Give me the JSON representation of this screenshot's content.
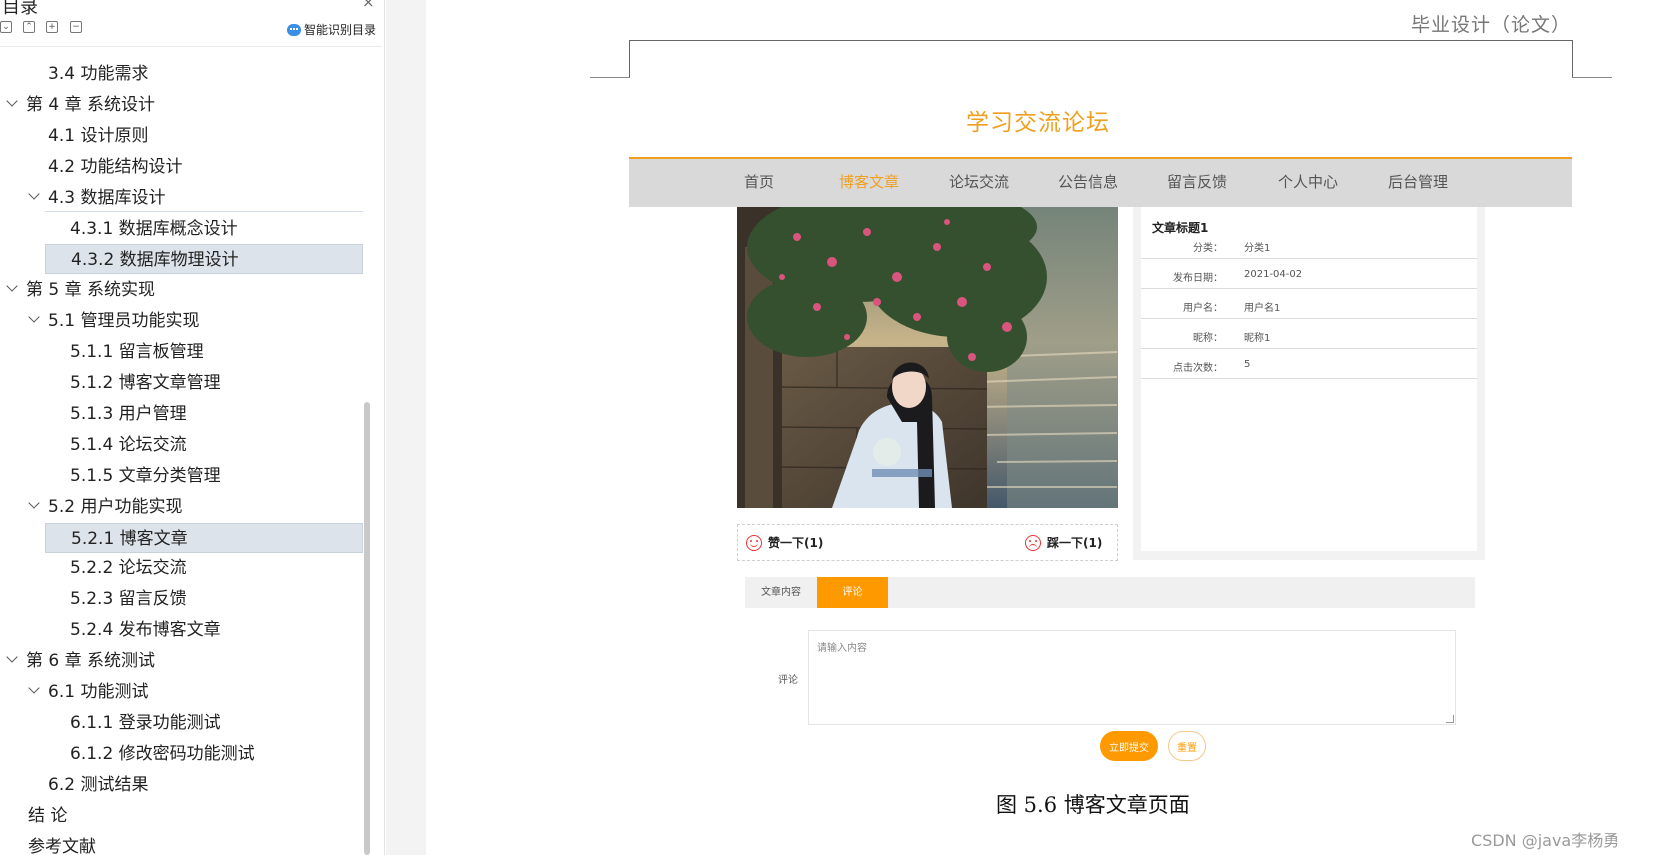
{
  "toc": {
    "title": "目录",
    "close_glyph": "×",
    "tools": [
      {
        "icon": "collapse-all-icon",
        "glyph": "⌄"
      },
      {
        "icon": "expand-up-icon",
        "glyph": "⌃"
      },
      {
        "icon": "plus-icon",
        "glyph": "+"
      },
      {
        "icon": "minus-icon",
        "glyph": "−"
      }
    ],
    "smart_directory": "智能识别目录",
    "items": [
      {
        "label": "3.4  功能需求",
        "level": 1,
        "expandable": false,
        "selected": false
      },
      {
        "label": "第 4 章  系统设计",
        "level": 0,
        "expandable": true,
        "selected": false
      },
      {
        "label": "4.1  设计原则",
        "level": 1,
        "expandable": false,
        "selected": false
      },
      {
        "label": "4.2  功能结构设计",
        "level": 1,
        "expandable": false,
        "selected": false
      },
      {
        "label": "4.3  数据库设计",
        "level": 1,
        "expandable": true,
        "selected": false
      },
      {
        "label": "4.3.1  数据库概念设计",
        "level": 2,
        "expandable": false,
        "selected": false
      },
      {
        "label": "4.3.2  数据库物理设计",
        "level": 2,
        "expandable": false,
        "selected": true
      },
      {
        "label": "第 5 章  系统实现",
        "level": 0,
        "expandable": true,
        "selected": false
      },
      {
        "label": "5.1  管理员功能实现",
        "level": 1,
        "expandable": true,
        "selected": false
      },
      {
        "label": "5.1.1  留言板管理",
        "level": 2,
        "expandable": false,
        "selected": false
      },
      {
        "label": "5.1.2  博客文章管理",
        "level": 2,
        "expandable": false,
        "selected": false
      },
      {
        "label": "5.1.3  用户管理",
        "level": 2,
        "expandable": false,
        "selected": false
      },
      {
        "label": "5.1.4  论坛交流",
        "level": 2,
        "expandable": false,
        "selected": false
      },
      {
        "label": "5.1.5  文章分类管理",
        "level": 2,
        "expandable": false,
        "selected": false
      },
      {
        "label": "5.2  用户功能实现",
        "level": 1,
        "expandable": true,
        "selected": false
      },
      {
        "label": "5.2.1  博客文章",
        "level": 2,
        "expandable": false,
        "selected": true
      },
      {
        "label": "5.2.2  论坛交流",
        "level": 2,
        "expandable": false,
        "selected": false
      },
      {
        "label": "5.2.3  留言反馈",
        "level": 2,
        "expandable": false,
        "selected": false
      },
      {
        "label": "5.2.4  发布博客文章",
        "level": 2,
        "expandable": false,
        "selected": false
      },
      {
        "label": "第 6 章  系统测试",
        "level": 0,
        "expandable": true,
        "selected": false
      },
      {
        "label": "6.1  功能测试",
        "level": 1,
        "expandable": true,
        "selected": false
      },
      {
        "label": "6.1.1  登录功能测试",
        "level": 2,
        "expandable": false,
        "selected": false
      },
      {
        "label": "6.1.2  修改密码功能测试",
        "level": 2,
        "expandable": false,
        "selected": false
      },
      {
        "label": "6.2  测试结果",
        "level": 1,
        "expandable": false,
        "selected": false
      },
      {
        "label": "结    论",
        "level": 0,
        "expandable": false,
        "selected": false
      },
      {
        "label": "参考文献",
        "level": 0,
        "expandable": false,
        "selected": false
      }
    ]
  },
  "document": {
    "header_text": "毕业设计（论文）",
    "figure_caption": "图 5.6  博客文章页面",
    "watermark": "CSDN @java李杨勇"
  },
  "site": {
    "title": "学习交流论坛",
    "accent_color": "#f0a020",
    "nav": [
      {
        "label": "首页",
        "active": false
      },
      {
        "label": "博客文章",
        "active": true
      },
      {
        "label": "论坛交流",
        "active": false
      },
      {
        "label": "公告信息",
        "active": false
      },
      {
        "label": "留言反馈",
        "active": false
      },
      {
        "label": "个人中心",
        "active": false
      },
      {
        "label": "后台管理",
        "active": false
      }
    ],
    "article": {
      "title": "文章标题1",
      "fields": [
        {
          "key": "分类：",
          "value": "分类1"
        },
        {
          "key": "发布日期：",
          "value": "2021-04-02"
        },
        {
          "key": "用户名：",
          "value": "用户名1"
        },
        {
          "key": "昵称：",
          "value": "昵称1"
        },
        {
          "key": "点击次数：",
          "value": "5"
        }
      ]
    },
    "votes": {
      "like": "赞一下(1)",
      "dislike": "踩一下(1)"
    },
    "tabs": [
      {
        "label": "文章内容",
        "active": false
      },
      {
        "label": "评论",
        "active": true
      }
    ],
    "comment": {
      "label": "评论",
      "placeholder": "请输入内容",
      "value": "",
      "submit": "立即提交",
      "reset": "重置"
    }
  }
}
